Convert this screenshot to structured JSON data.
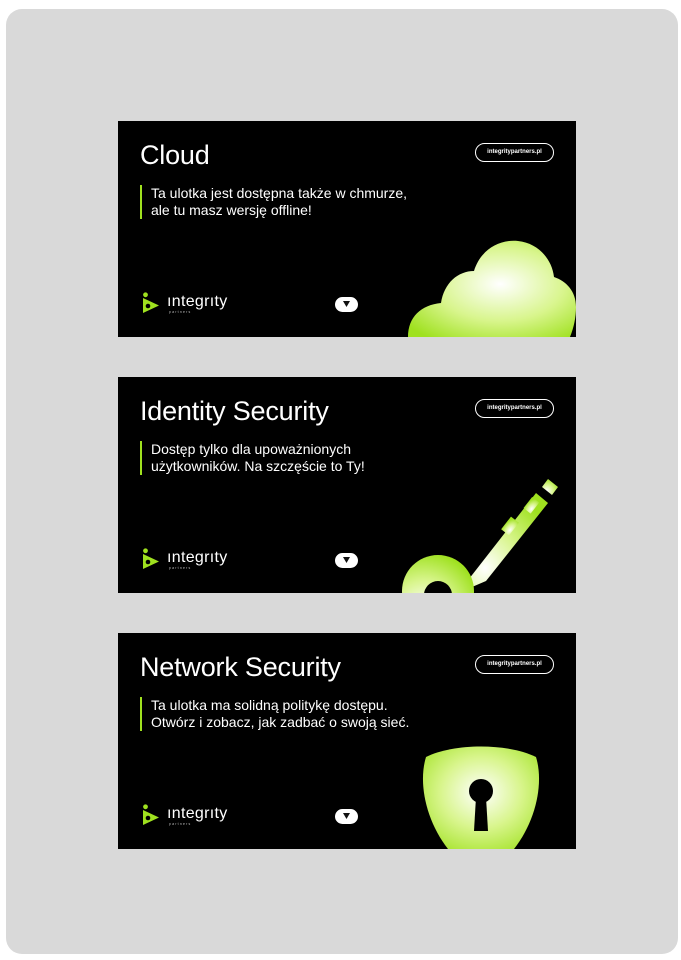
{
  "banners": [
    {
      "title": "Cloud",
      "url": "integritypartners.pl",
      "description_lines": [
        "Ta ulotka jest dostępna także w chmurze,",
        "ale tu masz wersję offline!"
      ],
      "brand_name": "ıntegrıty",
      "brand_sub": "partners",
      "illustration_icon": "cloud-icon"
    },
    {
      "title": "Identity Security",
      "url": "integritypartners.pl",
      "description_lines": [
        "Dostęp tylko dla upoważnionych",
        "użytkowników. Na szczęście to Ty!"
      ],
      "brand_name": "ıntegrıty",
      "brand_sub": "partners",
      "illustration_icon": "key-icon"
    },
    {
      "title": "Network Security",
      "url": "integritypartners.pl",
      "description_lines": [
        "Ta ulotka ma solidną politykę dostępu.",
        "Otwórz i zobacz, jak zadbać o swoją sieć."
      ],
      "brand_name": "ıntegrıty",
      "brand_sub": "partners",
      "illustration_icon": "shield-keyhole-icon"
    }
  ],
  "colors": {
    "panel_background": "#d9d9d9",
    "banner_background": "#000000",
    "accent": "#9fe11f",
    "text": "#ffffff"
  }
}
